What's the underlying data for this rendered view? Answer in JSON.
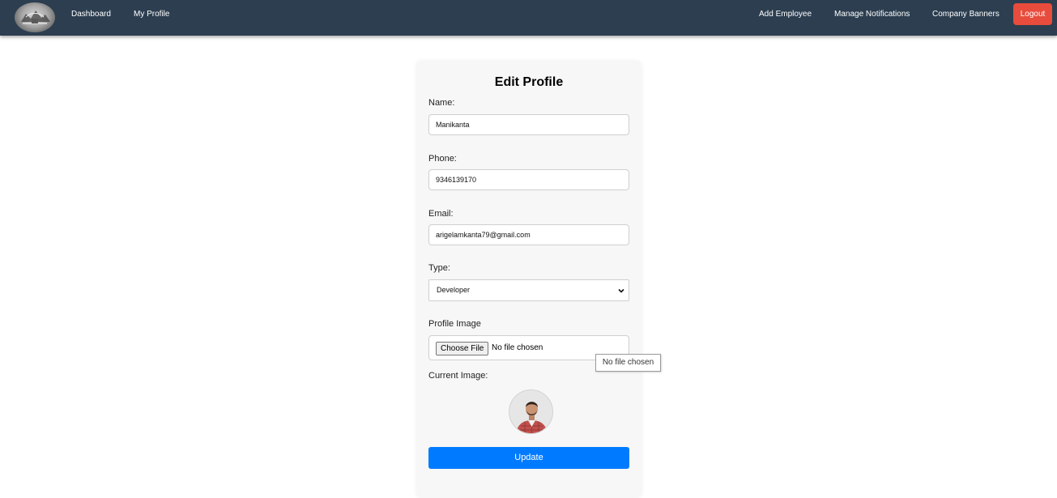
{
  "nav": {
    "logo": "company-logo",
    "left_links": [
      "Dashboard",
      "My Profile"
    ],
    "right_links": [
      "Add Employee",
      "Manage Notifications",
      "Company Banners"
    ],
    "logout_label": "Logout",
    "colors": {
      "navbar": "#2c3e50",
      "logout": "#e74c3c"
    }
  },
  "form": {
    "title": "Edit Profile",
    "name_label": "Name:",
    "name_value": "Manikanta",
    "phone_label": "Phone:",
    "phone_value": "9346139170",
    "email_label": "Email:",
    "email_value": "arigelamkanta79@gmail.com",
    "type_label": "Type:",
    "type_value": "Developer",
    "profile_image_label": "Profile Image",
    "choose_file_label": "Choose File",
    "file_status": "No file chosen",
    "tooltip": "No file chosen",
    "current_image_label": "Current Image:",
    "update_label": "Update",
    "colors": {
      "update": "#007bff"
    }
  }
}
